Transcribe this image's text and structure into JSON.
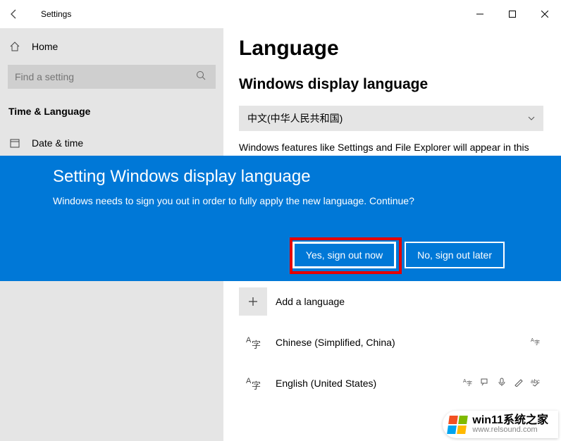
{
  "titlebar": {
    "title": "Settings"
  },
  "sidebar": {
    "home_label": "Home",
    "search_placeholder": "Find a setting",
    "section_label": "Time & Language",
    "items": [
      {
        "label": "Date & time"
      }
    ]
  },
  "content": {
    "page_title": "Language",
    "section_title": "Windows display language",
    "selected_language": "中文(中华人民共和国)",
    "description": "Windows features like Settings and File Explorer will appear in this language.",
    "add_language_label": "Add a language",
    "languages": [
      {
        "name": "Chinese (Simplified, China)"
      },
      {
        "name": "English (United States)"
      }
    ]
  },
  "modal": {
    "title": "Setting Windows display language",
    "text": "Windows needs to sign you out in order to fully apply the new language. Continue?",
    "yes": "Yes, sign out now",
    "no": "No, sign out later"
  },
  "watermark": {
    "line1": "win11系统之家",
    "line2": "www.relsound.com"
  }
}
